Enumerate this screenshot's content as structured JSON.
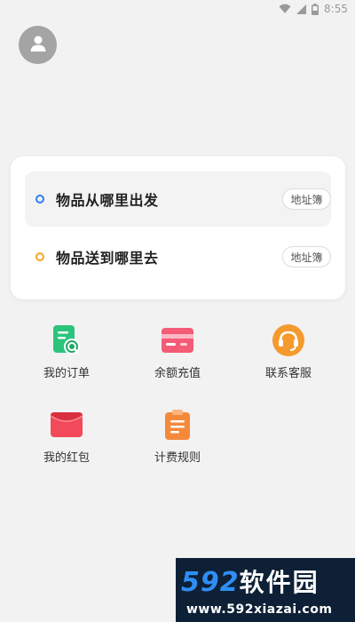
{
  "status_bar": {
    "time": "8:55",
    "icons": [
      "wifi-icon",
      "signal-icon",
      "battery-icon"
    ]
  },
  "profile": {
    "icon": "user-icon"
  },
  "address_card": {
    "from_label": "物品从哪里出发",
    "to_label": "物品送到哪里去",
    "book_label": "地址簿",
    "colors": {
      "from_dot": "#2e7ff0",
      "to_dot": "#f5a623"
    }
  },
  "menu": {
    "items": [
      {
        "label": "我的订单",
        "icon": "order-search-icon",
        "color": "#2cc47c"
      },
      {
        "label": "余额充值",
        "icon": "card-icon",
        "color": "#f45b76"
      },
      {
        "label": "联系客服",
        "icon": "headset-icon",
        "color": "#f59a2e"
      },
      {
        "label": "我的红包",
        "icon": "red-envelope-icon",
        "color": "#f24a5a"
      },
      {
        "label": "计费规则",
        "icon": "clipboard-icon",
        "color": "#f5893a"
      }
    ]
  },
  "watermark": {
    "brand": "592",
    "brand_cn": "软件园",
    "url": "www.592xiazai.com"
  }
}
